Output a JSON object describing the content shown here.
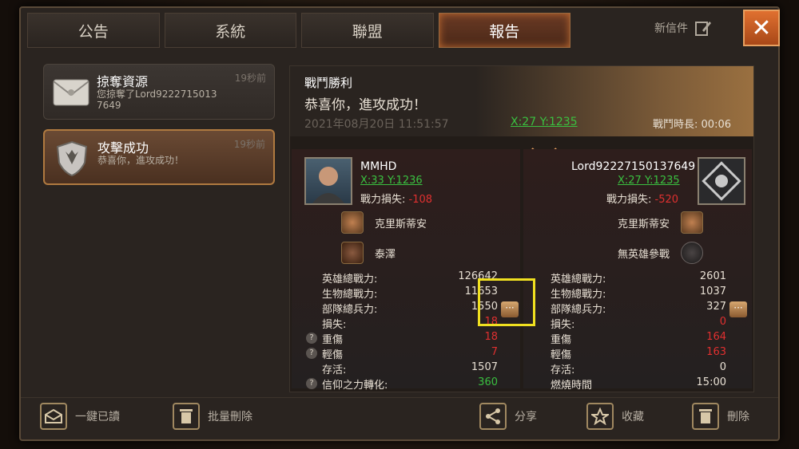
{
  "tabs": [
    {
      "label": "公告",
      "active": false
    },
    {
      "label": "系統",
      "active": false
    },
    {
      "label": "聯盟",
      "active": false
    },
    {
      "label": "報告",
      "active": true
    }
  ],
  "new_mail_label": "新信件",
  "mail_list": [
    {
      "title": "掠奪資源",
      "sub": "您掠奪了Lord9222715013 7649",
      "time": "19秒前",
      "icon": "envelope-icon",
      "selected": false
    },
    {
      "title": "攻擊成功",
      "sub": "恭喜你，進攻成功！",
      "time": "19秒前",
      "icon": "shield-wolf-icon",
      "selected": true
    }
  ],
  "report": {
    "title": "戰鬥勝利",
    "subtitle": "恭喜你，進攻成功！",
    "datetime": "2021年08月20日 11:51:57",
    "coord": "X:27 Y:1235",
    "duration": "戰鬥時長: 00:06"
  },
  "attacker": {
    "name": "MMHD",
    "coord": "X:33 Y:1236",
    "loss_label": "戰力損失:",
    "loss_value": "-108",
    "heroes": [
      "克里斯蒂安",
      "泰澤"
    ],
    "stats": [
      {
        "k": "英雄總戰力:",
        "v": "126642",
        "color": ""
      },
      {
        "k": "生物總戰力:",
        "v": "11653",
        "color": ""
      },
      {
        "k": "部隊總兵力:",
        "v": "1550",
        "color": ""
      },
      {
        "k": "損失:",
        "v": "18",
        "color": "red"
      },
      {
        "k": "重傷",
        "v": "18",
        "color": "red"
      },
      {
        "k": "輕傷",
        "v": "7",
        "color": "red"
      },
      {
        "k": "存活:",
        "v": "1507",
        "color": ""
      },
      {
        "k": "信仰之力轉化:",
        "v": "360",
        "color": "green"
      }
    ]
  },
  "defender": {
    "name": "Lord92227150137649",
    "coord": "X:27 Y:1235",
    "loss_label": "戰力損失:",
    "loss_value": "-520",
    "heroes": [
      "克里斯蒂安",
      "無英雄參戰"
    ],
    "stats": [
      {
        "k": "英雄總戰力:",
        "v": "2601",
        "color": ""
      },
      {
        "k": "生物總戰力:",
        "v": "1037",
        "color": ""
      },
      {
        "k": "部隊總兵力:",
        "v": "327",
        "color": ""
      },
      {
        "k": "損失:",
        "v": "0",
        "color": "red"
      },
      {
        "k": "重傷",
        "v": "164",
        "color": "red"
      },
      {
        "k": "輕傷",
        "v": "163",
        "color": "red"
      },
      {
        "k": "存活:",
        "v": "0",
        "color": ""
      },
      {
        "k": "燃燒時間",
        "v": "15:00",
        "color": ""
      }
    ]
  },
  "more_label": "···",
  "question_mark": "?",
  "close_label": "✕",
  "bottom": {
    "read_all": "一鍵已讀",
    "bulk_delete": "批量刪除",
    "share": "分享",
    "favorite": "收藏",
    "delete": "刪除"
  }
}
